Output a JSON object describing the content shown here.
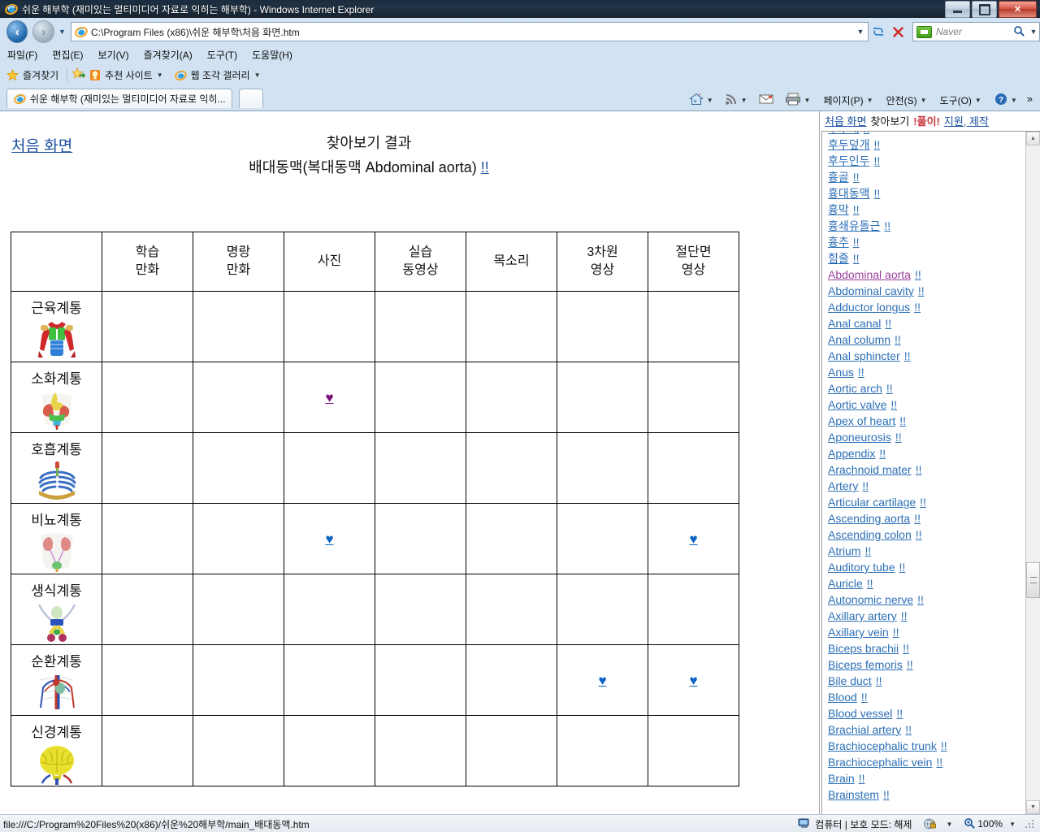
{
  "window": {
    "title": "쉬운 해부학 (재미있는 멀티미디어 자료로 익히는 해부학) - Windows Internet Explorer",
    "minimize_label": "최소화",
    "maximize_label": "최대화",
    "close_label": "닫기"
  },
  "navbar": {
    "back_label": "뒤로",
    "forward_label": "앞으로",
    "url": "C:\\Program Files (x86)\\쉬운 해부학\\처음 화면.htm",
    "refresh_label": "새로 고침",
    "stop_label": "중지",
    "search_placeholder": "Naver"
  },
  "menubar": {
    "items": [
      "파일(F)",
      "편집(E)",
      "보기(V)",
      "즐겨찾기(A)",
      "도구(T)",
      "도움말(H)"
    ]
  },
  "favbar": {
    "favorites_label": "즐겨찾기",
    "items": [
      "추천 사이트",
      "웹 조각 갤러리"
    ]
  },
  "tabs": [
    {
      "label": "쉬운 해부학 (재미있는 멀티미디어 자료로 익히..."
    }
  ],
  "commandbar": {
    "items": [
      "홈",
      "피드",
      "메일",
      "인쇄",
      "페이지(P)",
      "안전(S)",
      "도구(O)",
      "도움말",
      "더 보기"
    ],
    "overflow": "»"
  },
  "main": {
    "home_link": "처음 화면",
    "title_line1": "찾아보기 결과",
    "title_line2": "배대동맥(복대동맥 Abdominal aorta)",
    "title_line2_bang": "!!",
    "table": {
      "columns": [
        "",
        "학습\n만화",
        "명랑\n만화",
        "사진",
        "실습\n동영상",
        "목소리",
        "3차원\n영상",
        "절단면\n영상"
      ],
      "rows": [
        {
          "label": "근육계통",
          "icon": "muscular-system-icon",
          "cells": [
            "",
            "",
            "",
            "",
            "",
            "",
            ""
          ]
        },
        {
          "label": "소화계통",
          "icon": "digestive-system-icon",
          "cells": [
            "",
            "",
            "purple",
            "",
            "",
            "",
            ""
          ]
        },
        {
          "label": "호흡계통",
          "icon": "respiratory-system-icon",
          "cells": [
            "",
            "",
            "",
            "",
            "",
            "",
            ""
          ]
        },
        {
          "label": "비뇨계통",
          "icon": "urinary-system-icon",
          "cells": [
            "",
            "",
            "blue",
            "",
            "",
            "",
            "blue"
          ]
        },
        {
          "label": "생식계통",
          "icon": "reproductive-system-icon",
          "cells": [
            "",
            "",
            "",
            "",
            "",
            "",
            ""
          ]
        },
        {
          "label": "순환계통",
          "icon": "circulatory-system-icon",
          "cells": [
            "",
            "",
            "",
            "",
            "",
            "blue",
            "blue"
          ]
        },
        {
          "label": "신경계통",
          "icon": "nervous-system-icon",
          "cells": [
            "",
            "",
            "",
            "",
            "",
            "",
            ""
          ]
        }
      ],
      "heart_glyph": "♥"
    }
  },
  "sidebar": {
    "topnav": {
      "home": "처음 화면",
      "browse": "찾아보기",
      "solve": "!풀이!",
      "credits": "지원, 제작"
    },
    "bang": "!!",
    "items": [
      {
        "label": "후두개",
        "visited": false,
        "clipped": true
      },
      {
        "label": "후두덮개",
        "visited": false
      },
      {
        "label": "후두인두",
        "visited": false
      },
      {
        "label": "흉골",
        "visited": false
      },
      {
        "label": "흉대동맥",
        "visited": false
      },
      {
        "label": "흉막",
        "visited": false
      },
      {
        "label": "흉쇄유돌근",
        "visited": false
      },
      {
        "label": "흉추",
        "visited": false
      },
      {
        "label": "힘줄",
        "visited": false
      },
      {
        "label": "Abdominal aorta",
        "visited": true
      },
      {
        "label": "Abdominal cavity",
        "visited": false
      },
      {
        "label": "Adductor longus",
        "visited": false
      },
      {
        "label": "Anal canal",
        "visited": false
      },
      {
        "label": "Anal column",
        "visited": false
      },
      {
        "label": "Anal sphincter",
        "visited": false
      },
      {
        "label": "Anus",
        "visited": false
      },
      {
        "label": "Aortic arch",
        "visited": false
      },
      {
        "label": "Aortic valve",
        "visited": false
      },
      {
        "label": "Apex of heart",
        "visited": false
      },
      {
        "label": "Aponeurosis",
        "visited": false
      },
      {
        "label": "Appendix",
        "visited": false
      },
      {
        "label": "Arachnoid mater",
        "visited": false
      },
      {
        "label": "Artery",
        "visited": false
      },
      {
        "label": "Articular cartilage",
        "visited": false
      },
      {
        "label": "Ascending aorta",
        "visited": false
      },
      {
        "label": "Ascending colon",
        "visited": false
      },
      {
        "label": "Atrium",
        "visited": false
      },
      {
        "label": "Auditory tube",
        "visited": false
      },
      {
        "label": "Auricle",
        "visited": false
      },
      {
        "label": "Autonomic nerve",
        "visited": false
      },
      {
        "label": "Axillary artery",
        "visited": false
      },
      {
        "label": "Axillary vein",
        "visited": false
      },
      {
        "label": "Biceps brachii",
        "visited": false
      },
      {
        "label": "Biceps femoris",
        "visited": false
      },
      {
        "label": "Bile duct",
        "visited": false
      },
      {
        "label": "Blood",
        "visited": false
      },
      {
        "label": "Blood vessel",
        "visited": false
      },
      {
        "label": "Brachial artery",
        "visited": false
      },
      {
        "label": "Brachiocephalic trunk",
        "visited": false
      },
      {
        "label": "Brachiocephalic vein",
        "visited": false
      },
      {
        "label": "Brain",
        "visited": false
      },
      {
        "label": "Brainstem",
        "visited": false
      }
    ]
  },
  "statusbar": {
    "url": "file:///C:/Program%20Files%20(x86)/쉬운%20해부학/main_배대동맥.htm",
    "zone": "컴퓨터 | 보호 모드: 해제",
    "zoom": "100%"
  },
  "colors": {
    "link": "#2c6fb5",
    "visited_link": "#9b3f9b",
    "heart_blue": "#0c63c4",
    "heart_purple": "#7a0f7a",
    "titlebar": "#1b2b3d"
  }
}
